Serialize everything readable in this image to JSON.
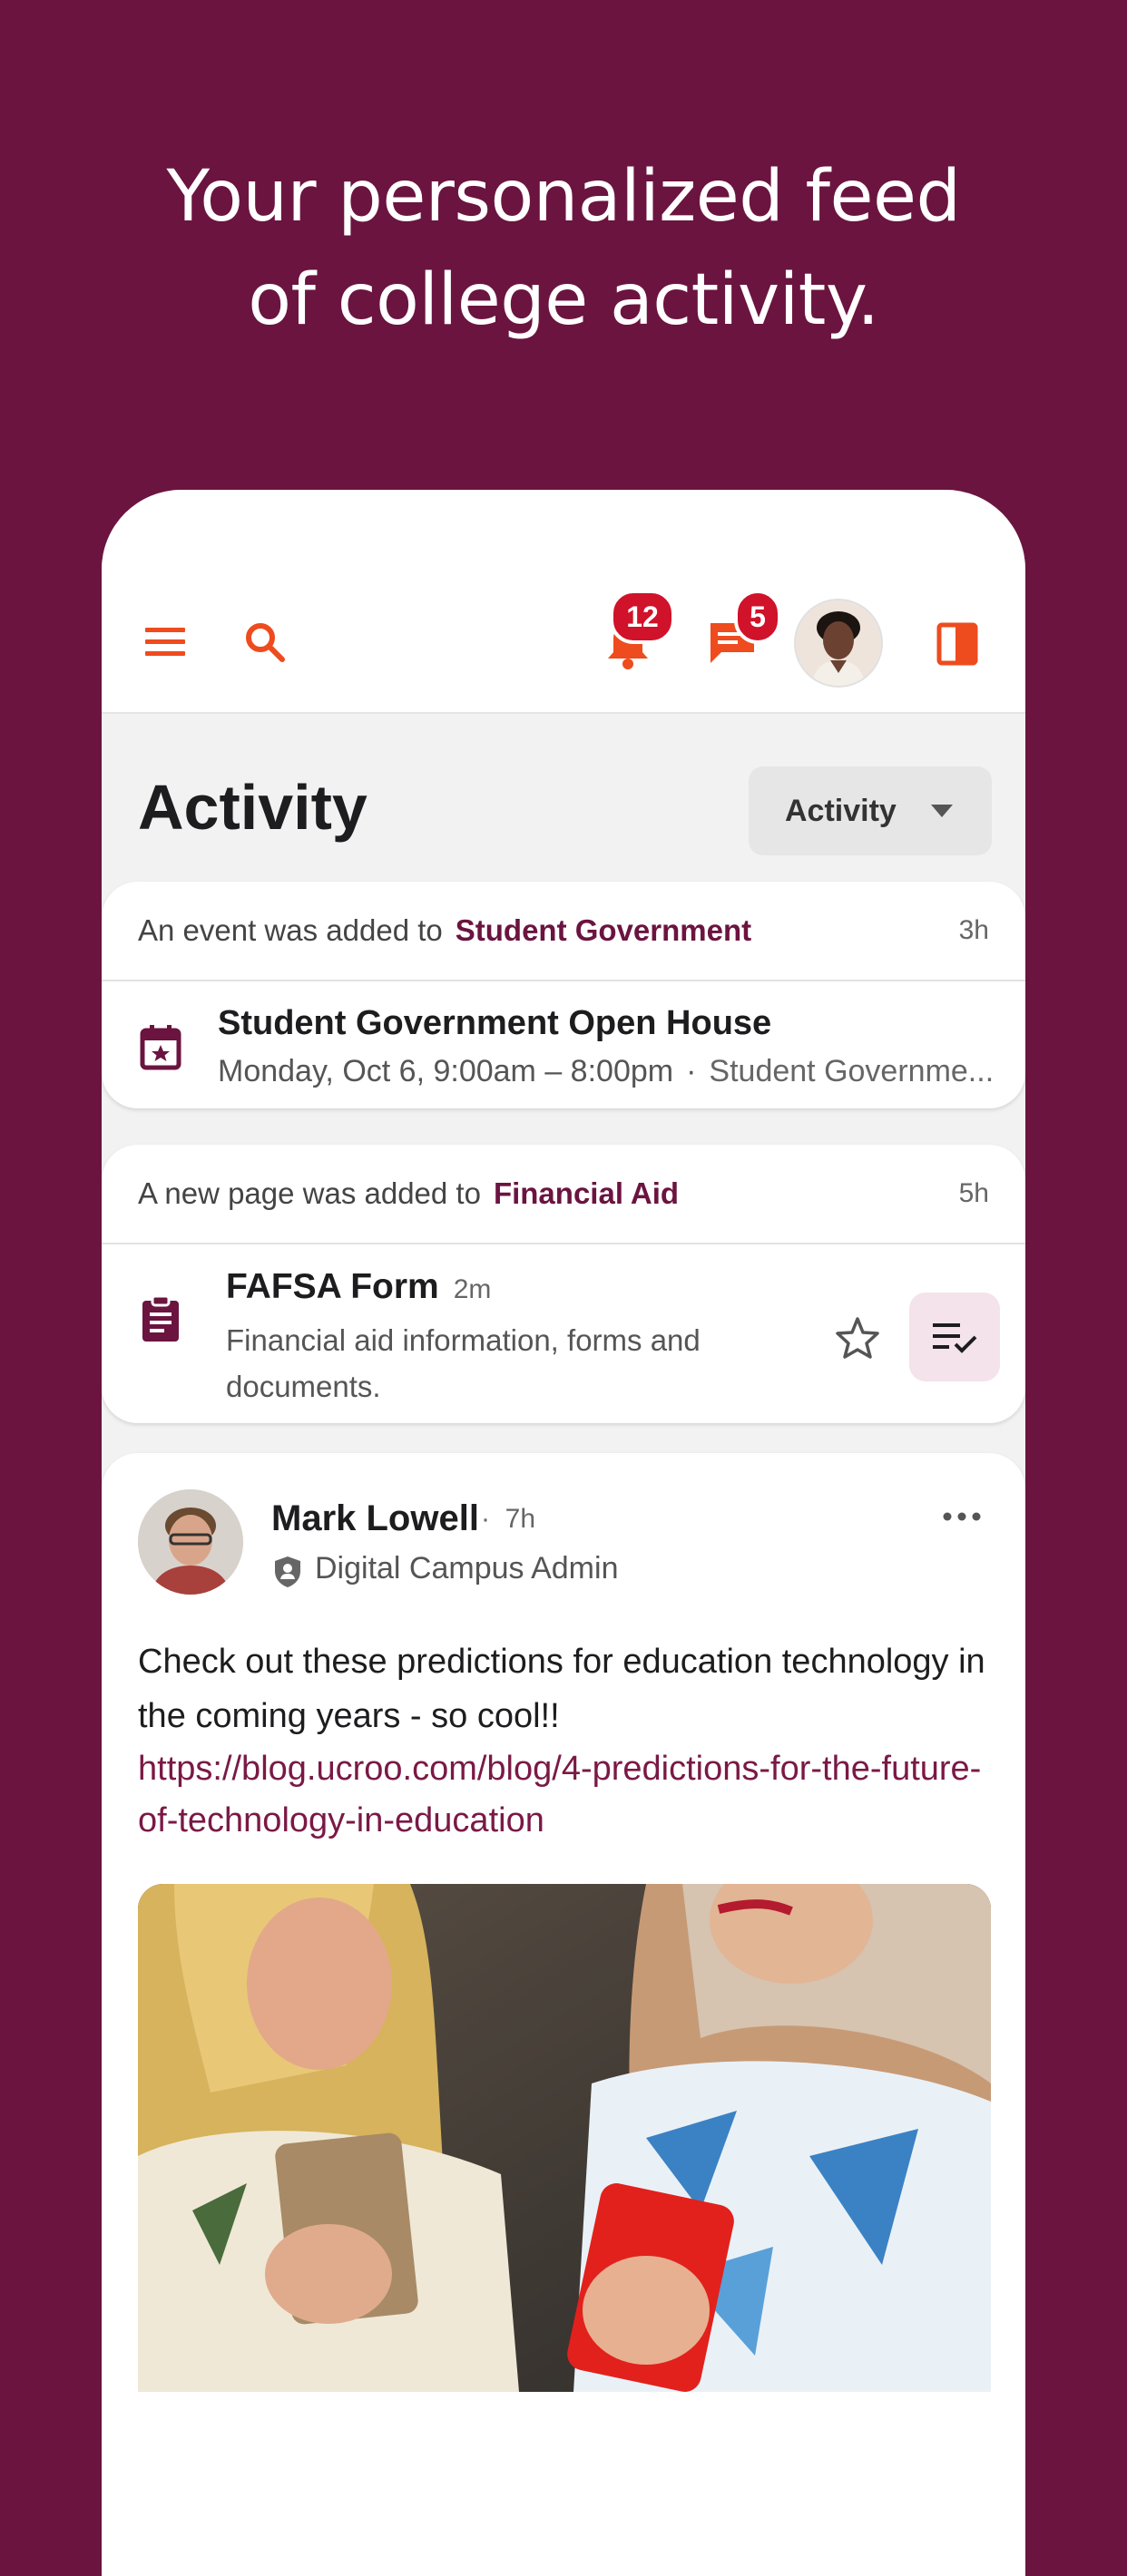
{
  "hero": {
    "line1": "Your personalized feed",
    "line2": "of college activity."
  },
  "topbar": {
    "menu_icon": "hamburger-menu-icon",
    "search_icon": "search-icon",
    "notifications_badge": "12",
    "messages_badge": "5",
    "colors": {
      "accent": "#ee4b1e",
      "badge": "#d0122a"
    }
  },
  "main": {
    "title": "Activity",
    "filter": {
      "selected": "Activity"
    }
  },
  "feed": {
    "event_card": {
      "head_text": "An event was added to",
      "head_link": "Student Government",
      "time": "3h",
      "event_title": "Student Government Open House",
      "event_when": "Monday, Oct 6, 9:00am – 8:00pm",
      "separator": "·",
      "event_group": "Student Governme..."
    },
    "page_card": {
      "head_text": "A new page was added to",
      "head_link": "Financial Aid",
      "time": "5h",
      "page_title": "FAFSA Form",
      "page_age": "2m",
      "page_desc": "Financial aid information, forms and documents."
    },
    "post_card": {
      "author": "Mark Lowell",
      "dot": "·",
      "age": "7h",
      "role": "Digital Campus Admin",
      "text": "Check out these predictions for education technology in the coming years - so cool!!",
      "link": "https://blog.ucroo.com/blog/4-predictions-for-the-future-of-technology-in-education"
    }
  },
  "colors": {
    "brand": "#6b1440",
    "accent": "#ee4b1e"
  }
}
